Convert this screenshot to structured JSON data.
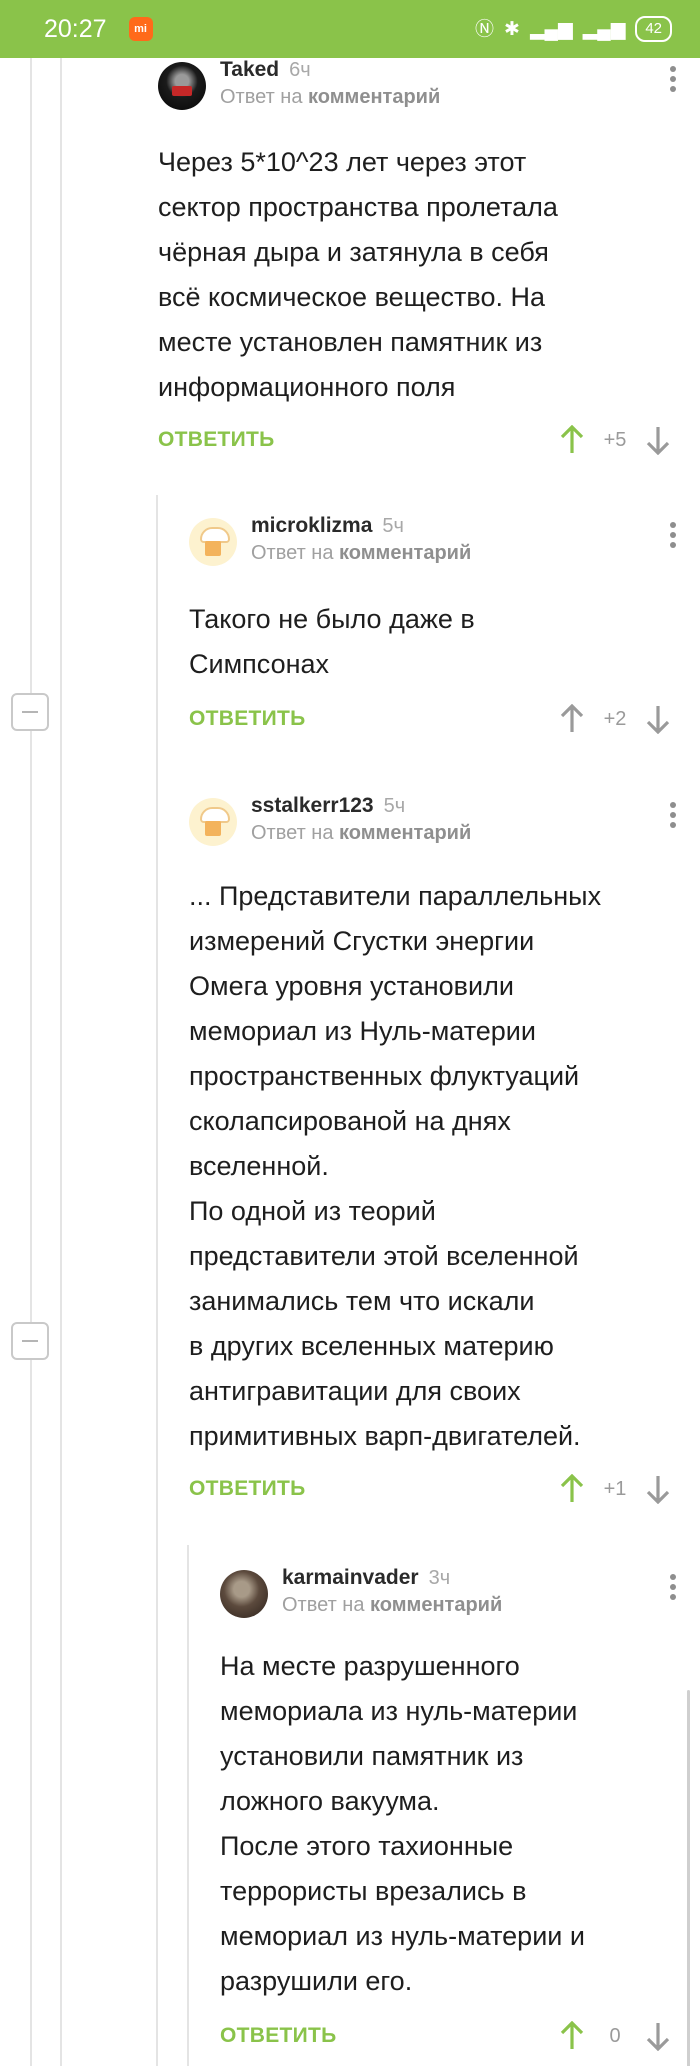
{
  "status_bar": {
    "time": "20:27",
    "app_icon": "mi-icon",
    "battery": "42"
  },
  "labels": {
    "reply_to_prefix": "Ответ на",
    "reply_to_target": "комментарий",
    "reply_button": "ОТВЕТИТЬ"
  },
  "comments": [
    {
      "author": "Taked",
      "time": "6ч",
      "avatar": "dark-avatar",
      "text": "Через 5*10^23 лет через этот\nсектор пространства пролетала\nчёрная дыра и затянула в себя\nвсё космическое вещество. На\nместе установлен памятник из\nинформационного поля",
      "score": "+5",
      "upvoted": true
    },
    {
      "author": "microklizma",
      "time": "5ч",
      "avatar": "placeholder-avatar",
      "text": "Такого не было даже в\nСимпсонах",
      "score": "+2",
      "upvoted": false
    },
    {
      "author": "sstalkerr123",
      "time": "5ч",
      "avatar": "placeholder-avatar",
      "text": "... Представители параллельных\nизмерений Сгустки энергии\nОмега уровня установили\nмемориал из Нуль-материи\nпространственных флуктуаций\nсколапсированой на днях\nвселенной.\nПо одной из теорий\nпредставители этой вселенной\nзанимались тем что искали\nв других вселенных материю\nантигравитации для своих\nпримитивных варп-двигателей.",
      "score": "+1",
      "upvoted": true
    },
    {
      "author": "karmainvader",
      "time": "3ч",
      "avatar": "helmet-avatar",
      "text": "На месте разрушенного\nмемориала из нуль-материи\nустановили памятник из\nложного вакуума.\nПосле этого тахионные\nтеррористы врезались в\nмемориал из нуль-материи и\nразрушили его.",
      "score": "0",
      "upvoted": true
    }
  ],
  "colors": {
    "accent": "#8ac34a",
    "upvote_active": "#8ac34a",
    "vote_inactive": "#9a9a9a"
  }
}
